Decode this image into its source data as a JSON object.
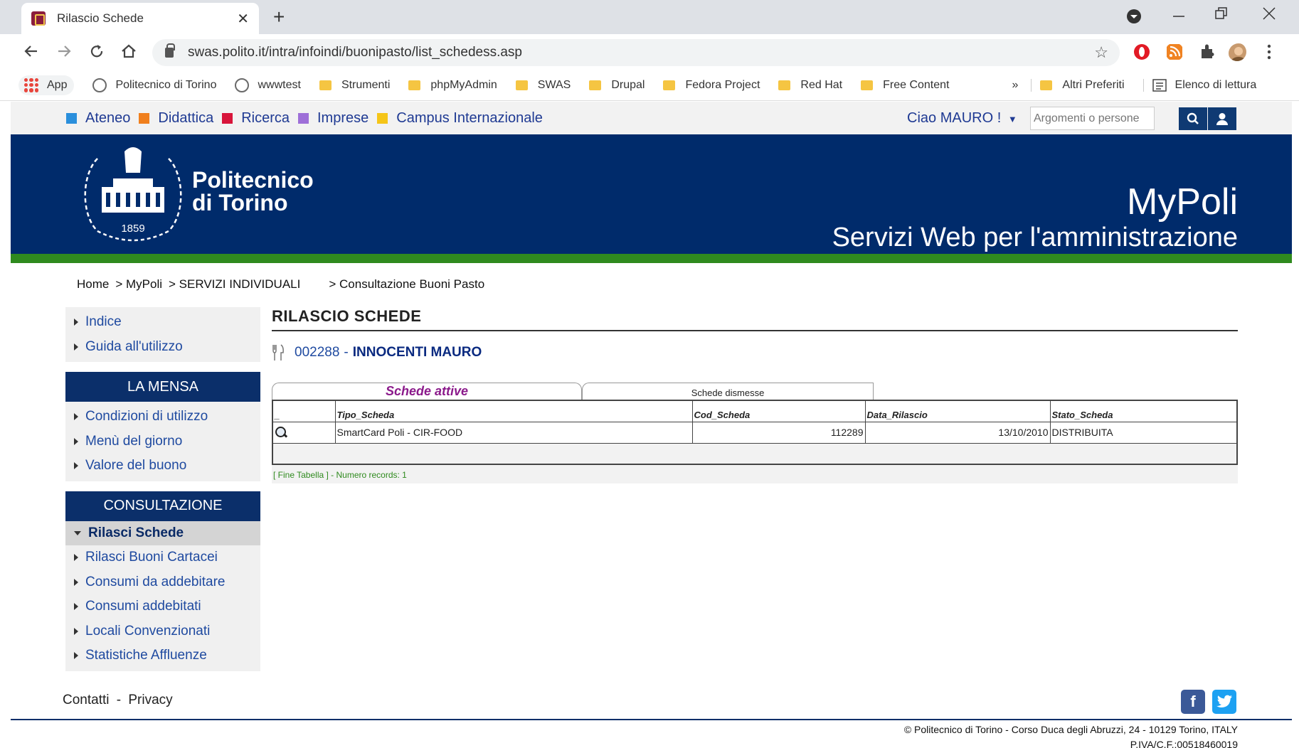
{
  "browser": {
    "tab_title": "Rilascio Schede",
    "tab_close": "✕",
    "new_tab": "+",
    "url": "swas.polito.it/intra/infoindi/buonipasto/list_schedess.asp",
    "bookmarks": [
      "App",
      "Politecnico di Torino",
      "wwwtest",
      "Strumenti",
      "phpMyAdmin",
      "SWAS",
      "Drupal",
      "Fedora Project",
      "Red Hat",
      "Free Content"
    ],
    "more_chevron": "»",
    "other_bookmarks": "Altri Preferiti",
    "reading_list": "Elenco di lettura"
  },
  "topbar": {
    "portals": [
      {
        "label": "Ateneo",
        "color": "#2a8fdc"
      },
      {
        "label": "Didattica",
        "color": "#f07f1d"
      },
      {
        "label": "Ricerca",
        "color": "#d8153a"
      },
      {
        "label": "Imprese",
        "color": "#9e6fd8"
      },
      {
        "label": "Campus Internazionale",
        "color": "#f5c518"
      }
    ],
    "greeting": "Ciao MAURO !",
    "search_placeholder": "Argomenti o persone"
  },
  "header": {
    "name_line1": "Politecnico",
    "name_line2": "di Torino",
    "seal_year": "1859",
    "app_name": "MyPoli",
    "subtitle": "Servizi Web per l'amministrazione"
  },
  "breadcrumb": [
    "Home",
    "> MyPoli",
    "> SERVIZI INDIVIDUALI",
    "> Consultazione Buoni Pasto"
  ],
  "sidebar": {
    "top_items": [
      "Indice",
      "Guida all'utilizzo"
    ],
    "mensa_title": "LA MENSA",
    "mensa_items": [
      "Condizioni di utilizzo",
      "Menù del giorno",
      "Valore del buono"
    ],
    "consultazione_title": "CONSULTAZIONE",
    "active_item": "Rilasci Schede",
    "consultazione_items": [
      "Rilasci Buoni Cartacei",
      "Consumi da addebitare",
      "Consumi addebitati",
      "Locali Convenzionati",
      "Statistiche Affluenze"
    ]
  },
  "main": {
    "title": "RILASCIO SCHEDE",
    "matricola": "002288",
    "separator": "-",
    "person_name": "INNOCENTI MAURO",
    "tab_active": "Schede attive",
    "tab_inactive": "Schede dismesse",
    "columns": [
      "_",
      "Tipo_Scheda",
      "Cod_Scheda",
      "Data_Rilascio",
      "Stato_Scheda"
    ],
    "rows": [
      {
        "tipo": "SmartCard Poli - CIR-FOOD",
        "cod": "112289",
        "data": "13/10/2010",
        "stato": "DISTRIBUITA"
      }
    ],
    "footer_note": "[ Fine Tabella ] - Numero records: 1"
  },
  "footer": {
    "contatti": "Contatti",
    "dash": "-",
    "privacy": "Privacy",
    "facebook": "f",
    "copyright_line1": "© Politecnico di Torino - Corso Duca degli Abruzzi, 24 - 10129 Torino, ITALY",
    "copyright_line2": "P.IVA/C.F.:00518460019"
  }
}
